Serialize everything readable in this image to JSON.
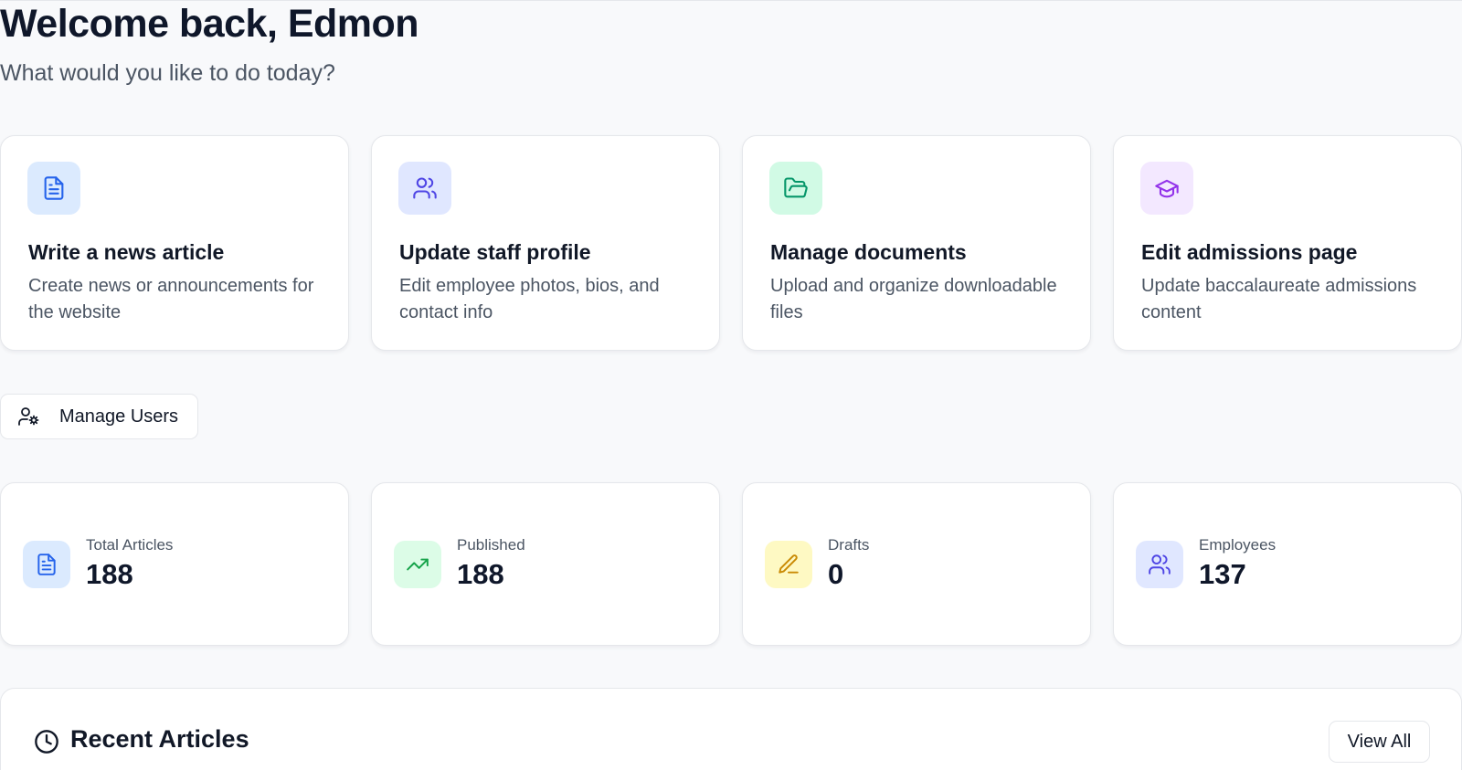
{
  "header": {
    "title": "Welcome back, Edmon",
    "subtitle": "What would you like to do today?"
  },
  "quick_actions": [
    {
      "title": "Write a news article",
      "description": "Create news or announcements for the website",
      "icon": "document-icon",
      "icon_color": "#2563eb",
      "icon_bg": "#dbeafe"
    },
    {
      "title": "Update staff profile",
      "description": "Edit employee photos, bios, and contact info",
      "icon": "users-icon",
      "icon_color": "#4f46e5",
      "icon_bg": "#e0e7ff"
    },
    {
      "title": "Manage documents",
      "description": "Upload and organize downloadable files",
      "icon": "folder-open-icon",
      "icon_color": "#059669",
      "icon_bg": "#d1fae5"
    },
    {
      "title": "Edit admissions page",
      "description": "Update baccalaureate admissions content",
      "icon": "graduation-cap-icon",
      "icon_color": "#9333ea",
      "icon_bg": "#f3e8ff"
    }
  ],
  "manage_users": {
    "label": "Manage Users",
    "icon": "user-cog-icon"
  },
  "stats": [
    {
      "label": "Total Articles",
      "value": "188",
      "icon": "document-icon",
      "icon_color": "#2563eb",
      "icon_bg": "#dbeafe"
    },
    {
      "label": "Published",
      "value": "188",
      "icon": "trending-up-icon",
      "icon_color": "#16a34a",
      "icon_bg": "#dcfce7"
    },
    {
      "label": "Drafts",
      "value": "0",
      "icon": "pencil-icon",
      "icon_color": "#ca8a04",
      "icon_bg": "#fef9c3"
    },
    {
      "label": "Employees",
      "value": "137",
      "icon": "users-icon",
      "icon_color": "#4f46e5",
      "icon_bg": "#e0e7ff"
    }
  ],
  "recent_articles": {
    "title": "Recent Articles",
    "icon": "clock-icon",
    "view_all_label": "View All"
  }
}
